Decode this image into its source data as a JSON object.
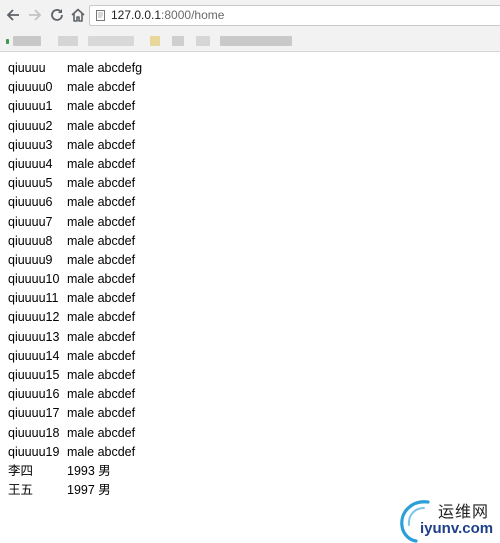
{
  "browser": {
    "url_host": "127.0.0.1",
    "url_path": ":8000/home"
  },
  "rows": [
    {
      "name": "qiuuuu",
      "rest": "male abcdefg"
    },
    {
      "name": "qiuuuu0",
      "rest": "male abcdef"
    },
    {
      "name": "qiuuuu1",
      "rest": "male abcdef"
    },
    {
      "name": "qiuuuu2",
      "rest": "male abcdef"
    },
    {
      "name": "qiuuuu3",
      "rest": "male abcdef"
    },
    {
      "name": "qiuuuu4",
      "rest": "male abcdef"
    },
    {
      "name": "qiuuuu5",
      "rest": "male abcdef"
    },
    {
      "name": "qiuuuu6",
      "rest": "male abcdef"
    },
    {
      "name": "qiuuuu7",
      "rest": "male abcdef"
    },
    {
      "name": "qiuuuu8",
      "rest": "male abcdef"
    },
    {
      "name": "qiuuuu9",
      "rest": "male abcdef"
    },
    {
      "name": "qiuuuu10",
      "rest": "male abcdef"
    },
    {
      "name": "qiuuuu11",
      "rest": "male abcdef"
    },
    {
      "name": "qiuuuu12",
      "rest": "male abcdef"
    },
    {
      "name": "qiuuuu13",
      "rest": "male abcdef"
    },
    {
      "name": "qiuuuu14",
      "rest": "male abcdef"
    },
    {
      "name": "qiuuuu15",
      "rest": "male abcdef"
    },
    {
      "name": "qiuuuu16",
      "rest": "male abcdef"
    },
    {
      "name": "qiuuuu17",
      "rest": "male abcdef"
    },
    {
      "name": "qiuuuu18",
      "rest": "male abcdef"
    },
    {
      "name": "qiuuuu19",
      "rest": "male abcdef"
    },
    {
      "name": "李四",
      "rest": "1993 男"
    },
    {
      "name": "王五",
      "rest": "1997 男"
    }
  ],
  "watermark": {
    "brand": "运维网",
    "domain": "iyunv.com"
  },
  "colors": {
    "toolbar_bg": "#f2f2f2",
    "icon_gray": "#5f6368",
    "watermark_blue": "#1f3f8a",
    "watermark_swoosh": "#2a9fd8"
  },
  "icons": {
    "back": "arrow-left-icon",
    "forward": "arrow-right-icon",
    "reload": "reload-icon",
    "home": "home-icon",
    "page_info": "page-info-icon"
  }
}
